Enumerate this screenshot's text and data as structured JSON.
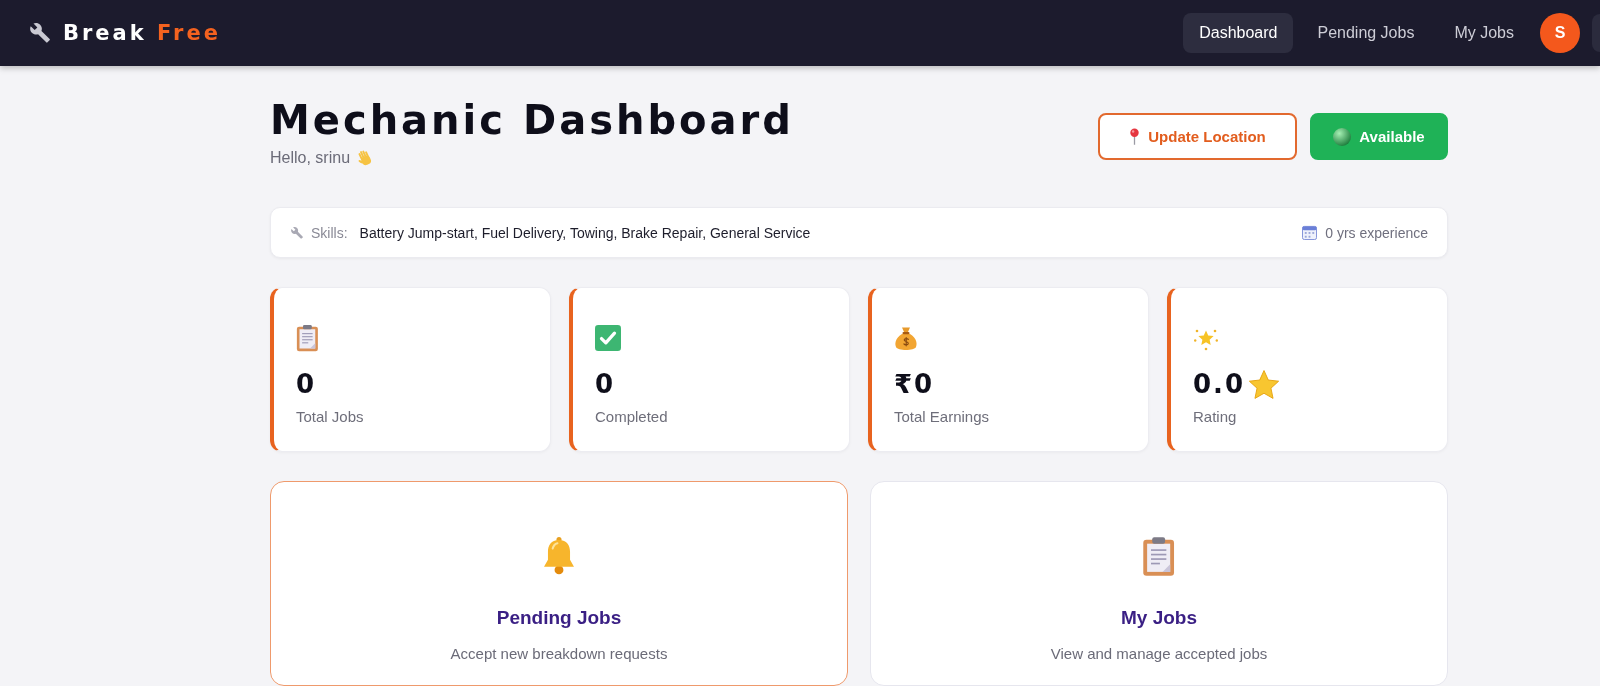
{
  "header": {
    "logo": {
      "first": "Break",
      "second": "Free"
    },
    "nav": [
      {
        "label": "Dashboard",
        "selected": true
      },
      {
        "label": "Pending Jobs",
        "selected": false
      },
      {
        "label": "My Jobs",
        "selected": false
      }
    ],
    "avatar": {
      "initial": "S"
    }
  },
  "page": {
    "title": "Mechanic Dashboard",
    "greeting": "Hello, srinu",
    "buttons": [
      {
        "kind": "location",
        "label": "Update Location"
      },
      {
        "kind": "status",
        "label": "Available",
        "on": true
      }
    ]
  },
  "skills_bar": {
    "label": "Skills:",
    "skills": "Battery Jump-start, Fuel Delivery, Towing, Brake Repair, General Service",
    "experience": "0 yrs experience"
  },
  "stats": [
    {
      "kind": "jobs",
      "value": "0",
      "label": "Total Jobs"
    },
    {
      "kind": "completed",
      "value": "0",
      "label": "Completed"
    },
    {
      "kind": "earnings",
      "value": "₹0",
      "label": "Total Earnings"
    },
    {
      "kind": "rating",
      "value": "0.0",
      "label": "Rating"
    }
  ],
  "actions": [
    {
      "kind": "pending",
      "title": "Pending Jobs",
      "subtitle": "Accept new breakdown requests",
      "selected": true
    },
    {
      "kind": "jobs",
      "title": "My Jobs",
      "subtitle": "View and manage accepted jobs",
      "selected": false
    }
  ]
}
